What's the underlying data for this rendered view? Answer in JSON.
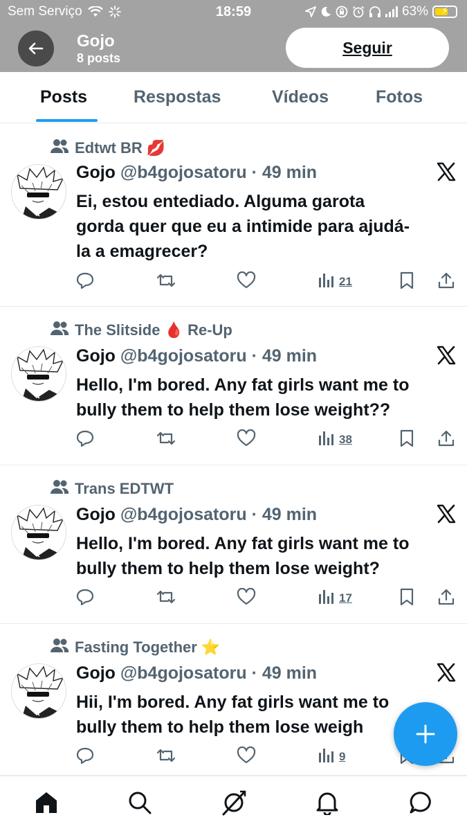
{
  "status_bar": {
    "carrier": "Sem Serviço",
    "time": "18:59",
    "battery_percent": "63%",
    "battery_level": 0.63
  },
  "profile_header": {
    "name": "Gojo",
    "post_count": "8 posts",
    "follow_label": "Seguir"
  },
  "tabs": [
    {
      "label": "Posts",
      "active": true
    },
    {
      "label": "Respostas",
      "active": false
    },
    {
      "label": "Vídeos",
      "active": false
    },
    {
      "label": "Fotos",
      "active": false
    }
  ],
  "posts": [
    {
      "community": "Edtwt BR 💋",
      "author": "Gojo",
      "handle": "@b4gojosatoru",
      "time": "· 49 min",
      "lines": [
        "Ei, estou entediado. Alguma garota",
        "gorda quer que eu a intimide para ajudá-",
        "la a emagrecer?"
      ],
      "views": "21"
    },
    {
      "community": "The Slitside 🩸 Re-Up",
      "author": "Gojo",
      "handle": "@b4gojosatoru",
      "time": "· 49 min",
      "lines": [
        "Hello, I'm bored. Any fat girls want me to",
        "bully them to help them lose weight??"
      ],
      "views": "38"
    },
    {
      "community": "Trans EDTWT",
      "author": "Gojo",
      "handle": "@b4gojosatoru",
      "time": "· 49 min",
      "lines": [
        "Hello, I'm bored. Any fat girls want me to",
        "bully them to help them lose weight?"
      ],
      "views": "17"
    },
    {
      "community": "Fasting Together ⭐",
      "author": "Gojo",
      "handle": "@b4gojosatoru",
      "time": "· 49 min",
      "lines": [
        "Hii, I'm bored. Any fat girls want me to",
        "bully them to help them lose weigh"
      ],
      "views": "9"
    }
  ],
  "bottom_nav": [
    "home-icon",
    "search-icon",
    "grok-icon",
    "notifications-icon",
    "messages-icon"
  ],
  "colors": {
    "accent": "#1d9bf0",
    "header_bg": "#a3a3a3",
    "muted": "#536471"
  }
}
